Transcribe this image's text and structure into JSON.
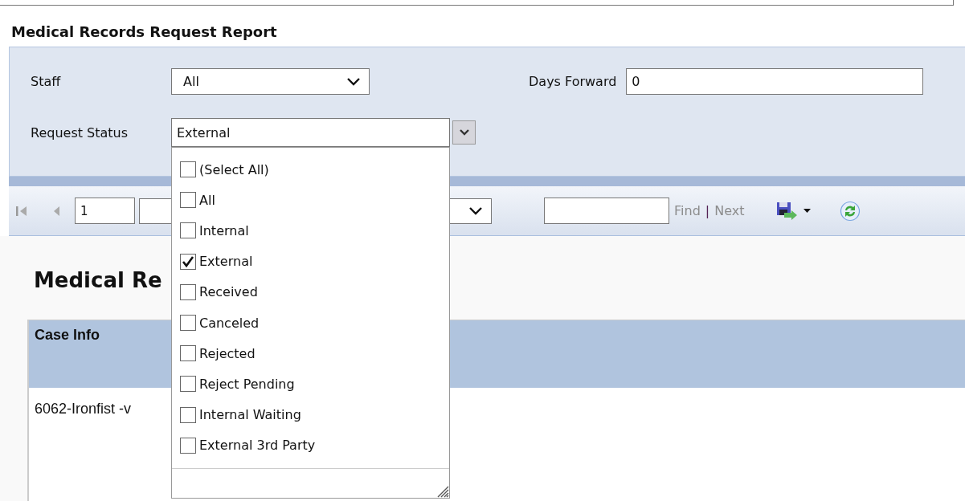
{
  "report_title": "Medical Records Request Report",
  "parameters": {
    "staff": {
      "label": "Staff",
      "value": "All"
    },
    "days_forward": {
      "label": "Days Forward",
      "value": "0"
    },
    "request_status": {
      "label": "Request Status",
      "value": "External",
      "expanded": true,
      "options": [
        {
          "label": "(Select All)",
          "checked": false
        },
        {
          "label": "All",
          "checked": false
        },
        {
          "label": "Internal",
          "checked": false
        },
        {
          "label": "External",
          "checked": true
        },
        {
          "label": "Received",
          "checked": false
        },
        {
          "label": "Canceled",
          "checked": false
        },
        {
          "label": "Rejected",
          "checked": false
        },
        {
          "label": "Reject Pending",
          "checked": false
        },
        {
          "label": "Internal Waiting",
          "checked": false
        },
        {
          "label": "External 3rd Party",
          "checked": false
        }
      ]
    }
  },
  "toolbar": {
    "page": "1",
    "find": {
      "label": "Find",
      "disabled": true
    },
    "separator": "|",
    "next": {
      "label": "Next",
      "disabled": true
    }
  },
  "report": {
    "heading": "Medical Re",
    "table": {
      "columns": [
        "Case Info"
      ],
      "rows": [
        [
          "6062-Ironfist -v"
        ]
      ]
    }
  }
}
